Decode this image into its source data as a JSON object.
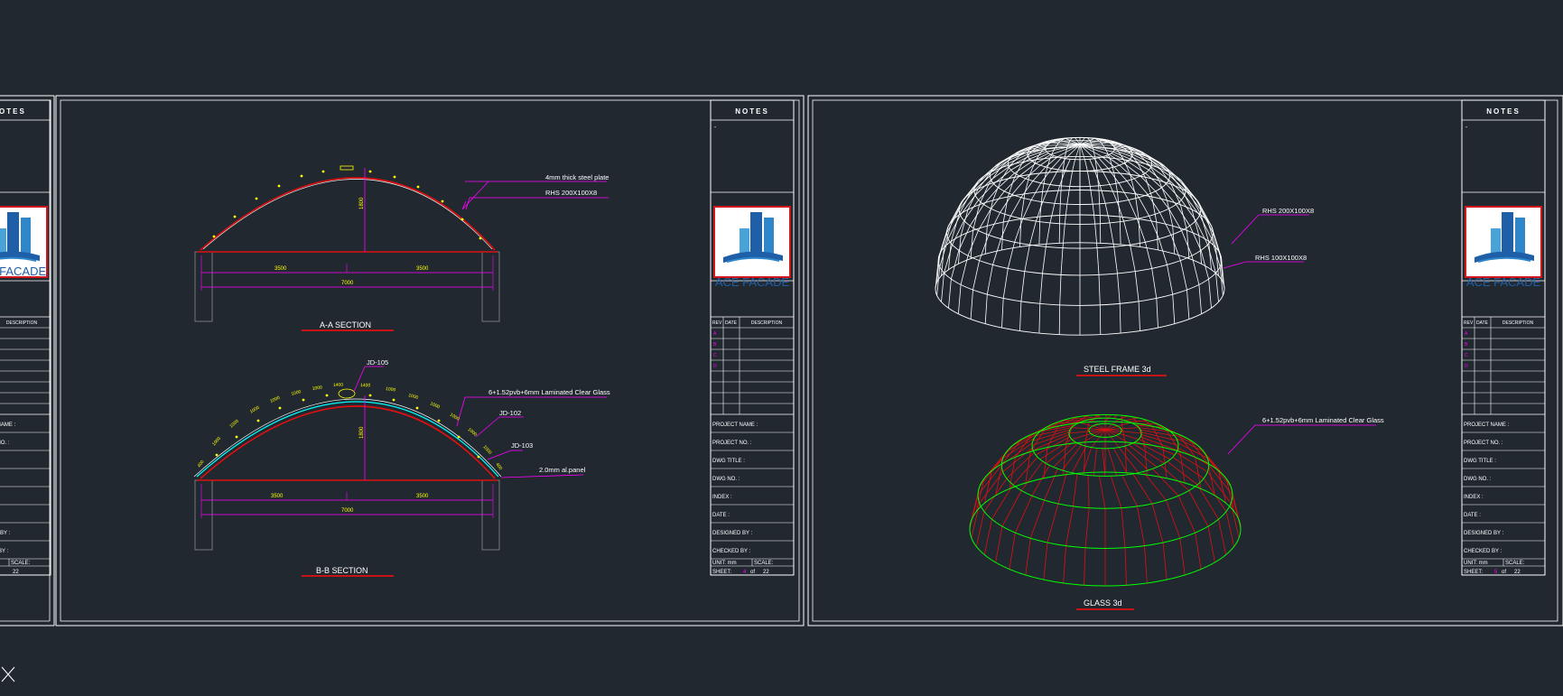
{
  "app": {
    "background": "#212830",
    "line_color": "#ffffff"
  },
  "title_block": {
    "notes_header": "NOTES",
    "notes_bullet": "-",
    "logo_text": "ACE FACADE",
    "rev_headers": [
      "REV",
      "DATE",
      "DESCRIPTION"
    ],
    "rev_marks": [
      "A",
      "B",
      "C",
      "D"
    ],
    "fields": [
      "PROJECT NAME :",
      "PROJECT NO. :",
      "DWG TITLE :",
      "DWG NO. :",
      "INDEX :",
      "DATE :",
      "DESIGNED BY :",
      "CHECKED BY :"
    ],
    "unit_label": "UNIT: mm",
    "scale_label": "SCALE:",
    "sheet_label": "SHEET:",
    "sheet_of": "of",
    "sheet_total": "22"
  },
  "left_partial_sheet": {
    "sheet_no": "3"
  },
  "sheet1": {
    "sheet_no": "4",
    "aa_section": {
      "title": "A-A SECTION",
      "note1": "4mm thick steel plate",
      "note2": "RHS 200X100X8",
      "dim_height": "1800",
      "dim_left": "3500",
      "dim_right": "3500",
      "dim_total": "7000"
    },
    "bb_section": {
      "title": "B-B SECTION",
      "callout_jd105": "JD-105",
      "callout_glass": "6+1.52pvb+6mm Laminated  Clear Glass",
      "callout_jd102": "JD-102",
      "callout_jd103": "JD-103",
      "callout_panel": "2.0mm al.panel",
      "dim_height": "1800",
      "dim_left": "3500",
      "dim_right": "3500",
      "dim_total": "7000",
      "arc_labels": [
        "400",
        "1000",
        "1000",
        "1000",
        "1000",
        "1000",
        "1000",
        "1400",
        "1400",
        "1000",
        "1000",
        "1000",
        "1000",
        "1000",
        "1000",
        "400"
      ]
    }
  },
  "sheet2": {
    "sheet_no": "5",
    "steel_frame": {
      "title": "STEEL FRAME 3d",
      "note1": "RHS 200X100X8",
      "note2": "RHS 100X100X8"
    },
    "glass": {
      "title": "GLASS 3d",
      "note": "6+1.52pvb+6mm Laminated  Clear Glass"
    }
  },
  "colors": {
    "magenta": "#ff00ff",
    "yellow": "#ffff00",
    "red_line": "#e01010",
    "green": "#00ff00",
    "cyan": "#00ffff",
    "grey": "#808080",
    "logo_blue": "#1f5fa8",
    "logo_red": "#d0151c"
  }
}
